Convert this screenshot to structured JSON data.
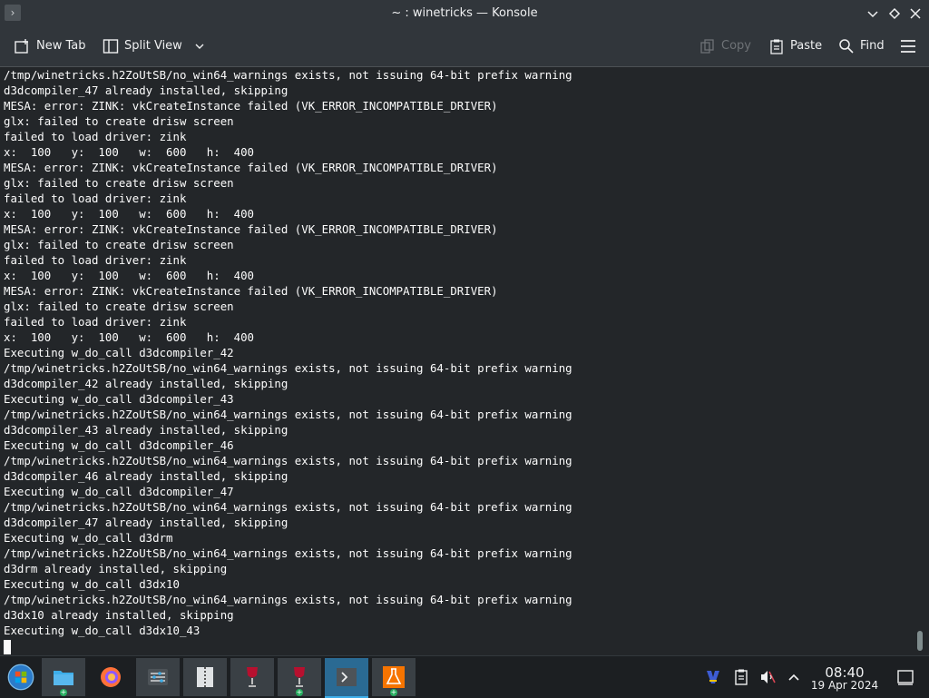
{
  "window": {
    "title": "~ : winetricks — Konsole"
  },
  "toolbar": {
    "new_tab_label": "New Tab",
    "split_view_label": "Split View",
    "copy_label": "Copy",
    "paste_label": "Paste",
    "find_label": "Find"
  },
  "terminal": {
    "lines": [
      "/tmp/winetricks.h2ZoUtSB/no_win64_warnings exists, not issuing 64-bit prefix warning",
      "d3dcompiler_47 already installed, skipping",
      "MESA: error: ZINK: vkCreateInstance failed (VK_ERROR_INCOMPATIBLE_DRIVER)",
      "glx: failed to create drisw screen",
      "failed to load driver: zink",
      "x:  100   y:  100   w:  600   h:  400",
      "MESA: error: ZINK: vkCreateInstance failed (VK_ERROR_INCOMPATIBLE_DRIVER)",
      "glx: failed to create drisw screen",
      "failed to load driver: zink",
      "x:  100   y:  100   w:  600   h:  400",
      "MESA: error: ZINK: vkCreateInstance failed (VK_ERROR_INCOMPATIBLE_DRIVER)",
      "glx: failed to create drisw screen",
      "failed to load driver: zink",
      "x:  100   y:  100   w:  600   h:  400",
      "MESA: error: ZINK: vkCreateInstance failed (VK_ERROR_INCOMPATIBLE_DRIVER)",
      "glx: failed to create drisw screen",
      "failed to load driver: zink",
      "x:  100   y:  100   w:  600   h:  400",
      "Executing w_do_call d3dcompiler_42",
      "/tmp/winetricks.h2ZoUtSB/no_win64_warnings exists, not issuing 64-bit prefix warning",
      "d3dcompiler_42 already installed, skipping",
      "Executing w_do_call d3dcompiler_43",
      "/tmp/winetricks.h2ZoUtSB/no_win64_warnings exists, not issuing 64-bit prefix warning",
      "d3dcompiler_43 already installed, skipping",
      "Executing w_do_call d3dcompiler_46",
      "/tmp/winetricks.h2ZoUtSB/no_win64_warnings exists, not issuing 64-bit prefix warning",
      "d3dcompiler_46 already installed, skipping",
      "Executing w_do_call d3dcompiler_47",
      "/tmp/winetricks.h2ZoUtSB/no_win64_warnings exists, not issuing 64-bit prefix warning",
      "d3dcompiler_47 already installed, skipping",
      "Executing w_do_call d3drm",
      "/tmp/winetricks.h2ZoUtSB/no_win64_warnings exists, not issuing 64-bit prefix warning",
      "d3drm already installed, skipping",
      "Executing w_do_call d3dx10",
      "/tmp/winetricks.h2ZoUtSB/no_win64_warnings exists, not issuing 64-bit prefix warning",
      "d3dx10 already installed, skipping",
      "Executing w_do_call d3dx10_43"
    ]
  },
  "taskbar": {
    "clock_time": "08:40",
    "clock_date": "19 Apr 2024"
  },
  "colors": {
    "background": "#232629",
    "chrome": "#31363b",
    "text": "#fcfcfc",
    "accent": "#3daee9",
    "taskbar": "#1c1f22"
  }
}
